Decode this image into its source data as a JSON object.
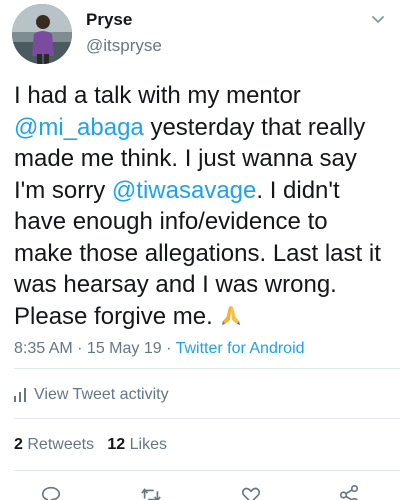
{
  "user": {
    "display_name": "Pryse",
    "handle": "@itspryse"
  },
  "tweet": {
    "part1": "I had a talk with my mentor ",
    "mention1": "@mi_abaga",
    "part2": " yesterday that really made me think. I just wanna say I'm sorry ",
    "mention2": "@tiwasavage",
    "part3": ". I didn't have enough info/evidence to make those allegations. Last last it was hearsay and I was wrong. Please forgive me. ",
    "emoji_icon": "folded-hands-icon"
  },
  "meta": {
    "time": "8:35 AM",
    "separator": " · ",
    "date": "15 May 19",
    "source": "Twitter for Android"
  },
  "activity": {
    "label": "View Tweet activity",
    "icon": "bar-chart-icon"
  },
  "stats": {
    "retweets_count": "2",
    "retweets_label": "Retweets",
    "likes_count": "12",
    "likes_label": "Likes"
  },
  "actions": {
    "icons": [
      "reply-icon",
      "retweet-icon",
      "like-icon",
      "share-icon"
    ]
  },
  "colors": {
    "accent": "#1da1f2",
    "muted": "#657786",
    "text": "#14171a",
    "divider": "#e1e8ed"
  }
}
